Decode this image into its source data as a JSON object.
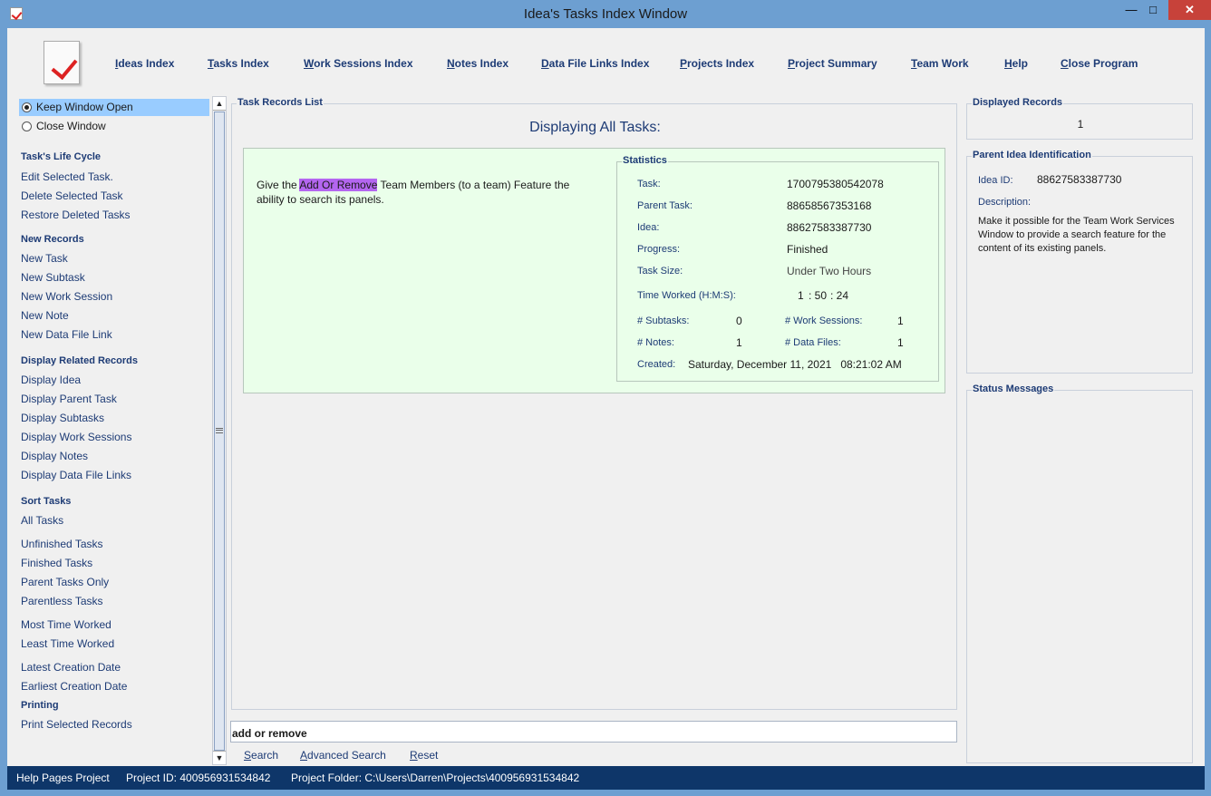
{
  "window": {
    "title": "Idea's Tasks Index Window",
    "min_glyph": "—",
    "max_glyph": "□",
    "close_glyph": "✕"
  },
  "menu": {
    "items": [
      {
        "label": "Ideas Index"
      },
      {
        "label": "Tasks Index"
      },
      {
        "label": "Work Sessions Index"
      },
      {
        "label": "Notes Index"
      },
      {
        "label": "Data File Links Index"
      },
      {
        "label": "Projects Index"
      },
      {
        "label": "Project Summary"
      },
      {
        "label": "Team Work"
      },
      {
        "label": "Help"
      },
      {
        "label": "Close Program"
      }
    ]
  },
  "left": {
    "keep_open": "Keep Window Open",
    "close_window": "Close Window",
    "life_cycle": {
      "head": "Task's Life Cycle",
      "items": [
        "Edit Selected Task.",
        "Delete Selected Task",
        "Restore Deleted Tasks"
      ]
    },
    "new_records": {
      "head": "New Records",
      "items": [
        "New Task",
        "New Subtask",
        "New Work Session",
        "New Note",
        "New Data File Link"
      ]
    },
    "related": {
      "head": "Display Related Records",
      "items": [
        "Display Idea",
        "Display Parent Task",
        "Display Subtasks",
        "Display Work Sessions",
        "Display Notes",
        "Display Data File Links"
      ]
    },
    "sort": {
      "head": "Sort Tasks",
      "items": [
        "All Tasks",
        "Unfinished Tasks",
        "Finished Tasks",
        "Parent Tasks Only",
        "Parentless Tasks",
        "Most Time Worked",
        "Least Time Worked",
        "Latest Creation Date",
        "Earliest Creation Date"
      ]
    },
    "printing": {
      "head": "Printing",
      "items": [
        "Print Selected Records"
      ]
    }
  },
  "task_list": {
    "legend": "Task Records List",
    "heading": "Displaying All Tasks:",
    "task": {
      "desc_before": "Give the ",
      "desc_highlight": "Add Or Remove",
      "desc_after": " Team Members (to a team) Feature the ability to search its panels.",
      "stats": {
        "legend": "Statistics",
        "task_label": "Task:",
        "task_value": "1700795380542078",
        "parent_label": "Parent Task:",
        "parent_value": "88658567353168",
        "idea_label": "Idea:",
        "idea_value": "88627583387730",
        "progress_label": "Progress:",
        "progress_value": "Finished",
        "size_label": "Task Size:",
        "size_value": "Under Two Hours",
        "time_label": "Time Worked (H:M:S):",
        "time_h": "1",
        "time_m": ": 50",
        "time_s": ": 24",
        "subtasks_label": "# Subtasks:",
        "subtasks_value": "0",
        "sessions_label": "# Work Sessions:",
        "sessions_value": "1",
        "notes_label": "# Notes:",
        "notes_value": "1",
        "files_label": "# Data Files:",
        "files_value": "1",
        "created_label": "Created:",
        "created_value": "Saturday, December 11, 2021   08:21:02 AM"
      }
    }
  },
  "search": {
    "value": "add or remove",
    "search_label": "Search",
    "advanced_label": "Advanced Search",
    "reset_label": "Reset"
  },
  "displayed": {
    "legend": "Displayed Records",
    "value": "1"
  },
  "parent_idea": {
    "legend": "Parent Idea Identification",
    "id_label": "Idea ID:",
    "id_value": "88627583387730",
    "desc_label": "Description:",
    "desc_value": "Make it possible for the Team Work Services Window to provide a search feature for the content of its existing panels."
  },
  "status_messages": {
    "legend": "Status Messages"
  },
  "statusbar": {
    "project": "Help Pages Project",
    "project_id": "Project ID:  400956931534842",
    "project_folder": "Project Folder:  C:\\Users\\Darren\\Projects\\400956931534842"
  }
}
